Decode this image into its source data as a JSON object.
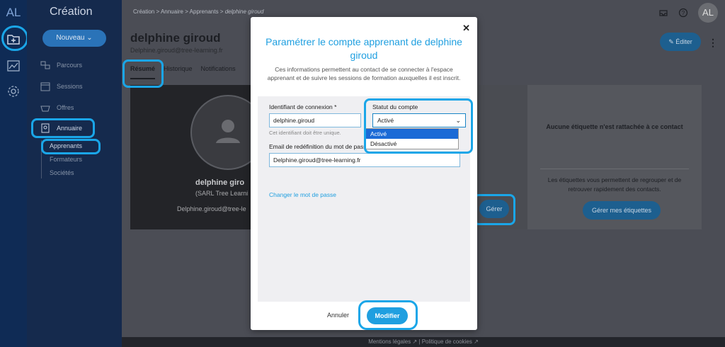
{
  "rail": {
    "logo": "AL",
    "icons": [
      "folder-plus-icon",
      "chart-icon",
      "gear-icon"
    ]
  },
  "sidebar": {
    "title": "Création",
    "new_button": "Nouveau ⌄",
    "items": [
      {
        "label": "Parcours",
        "icon": "parcours-icon"
      },
      {
        "label": "Sessions",
        "icon": "calendar-icon"
      },
      {
        "label": "Offres",
        "icon": "basket-icon"
      },
      {
        "label": "Annuaire",
        "icon": "contacts-book-icon"
      }
    ],
    "subitems": [
      "Apprenants",
      "Formateurs",
      "Sociétés"
    ]
  },
  "breadcrumb": {
    "items": [
      "Création",
      "Annuaire",
      "Apprenants"
    ],
    "current": "delphine giroud"
  },
  "topbar": {
    "avatar": "AL"
  },
  "profile": {
    "name": "delphine giroud",
    "email": "Delphine.giroud@tree-learning.fr",
    "edit_button": "Éditer",
    "tabs": [
      "Résumé",
      "Historique",
      "Notifications"
    ],
    "card_name": "delphine giro",
    "card_org": "(SARL Tree Learni",
    "card_email": "Delphine.giroud@tree-le"
  },
  "tags_card": {
    "empty_title": "Aucune étiquette n'est rattachée à ce contact",
    "description": "Les étiquettes vous permettent de regrouper et de retrouver rapidement des contacts.",
    "manage_button": "Gérer mes étiquettes"
  },
  "manage_button": "Gérer",
  "footer": {
    "legal": "Mentions légales",
    "cookies": "Politique de cookies",
    "separator": "|"
  },
  "modal": {
    "title": "Paramétrer le compte apprenant de delphine giroud",
    "description": "Ces informations permettent au contact de se connecter à l'espace apprenant et de suivre les sessions de formation auxquelles il est inscrit.",
    "login_label": "Identifiant de connexion *",
    "login_value": "delphine.giroud",
    "login_help": "Cet identifiant doit être unique.",
    "status_label": "Statut du compte",
    "status_value": "Activé",
    "status_options": [
      "Activé",
      "Désactivé"
    ],
    "reset_email_label": "Email de redéfinition du mot de passe",
    "reset_email_value": "Delphine.giroud@tree-learning.fr",
    "change_password_link": "Changer le mot de passe",
    "cancel_button": "Annuler",
    "submit_button": "Modifier",
    "close_icon": "close-icon"
  },
  "colors": {
    "accent": "#1f9fe0",
    "highlight": "#1aa6e8",
    "sidebar": "#152a4d",
    "rail": "#0f2b55"
  }
}
